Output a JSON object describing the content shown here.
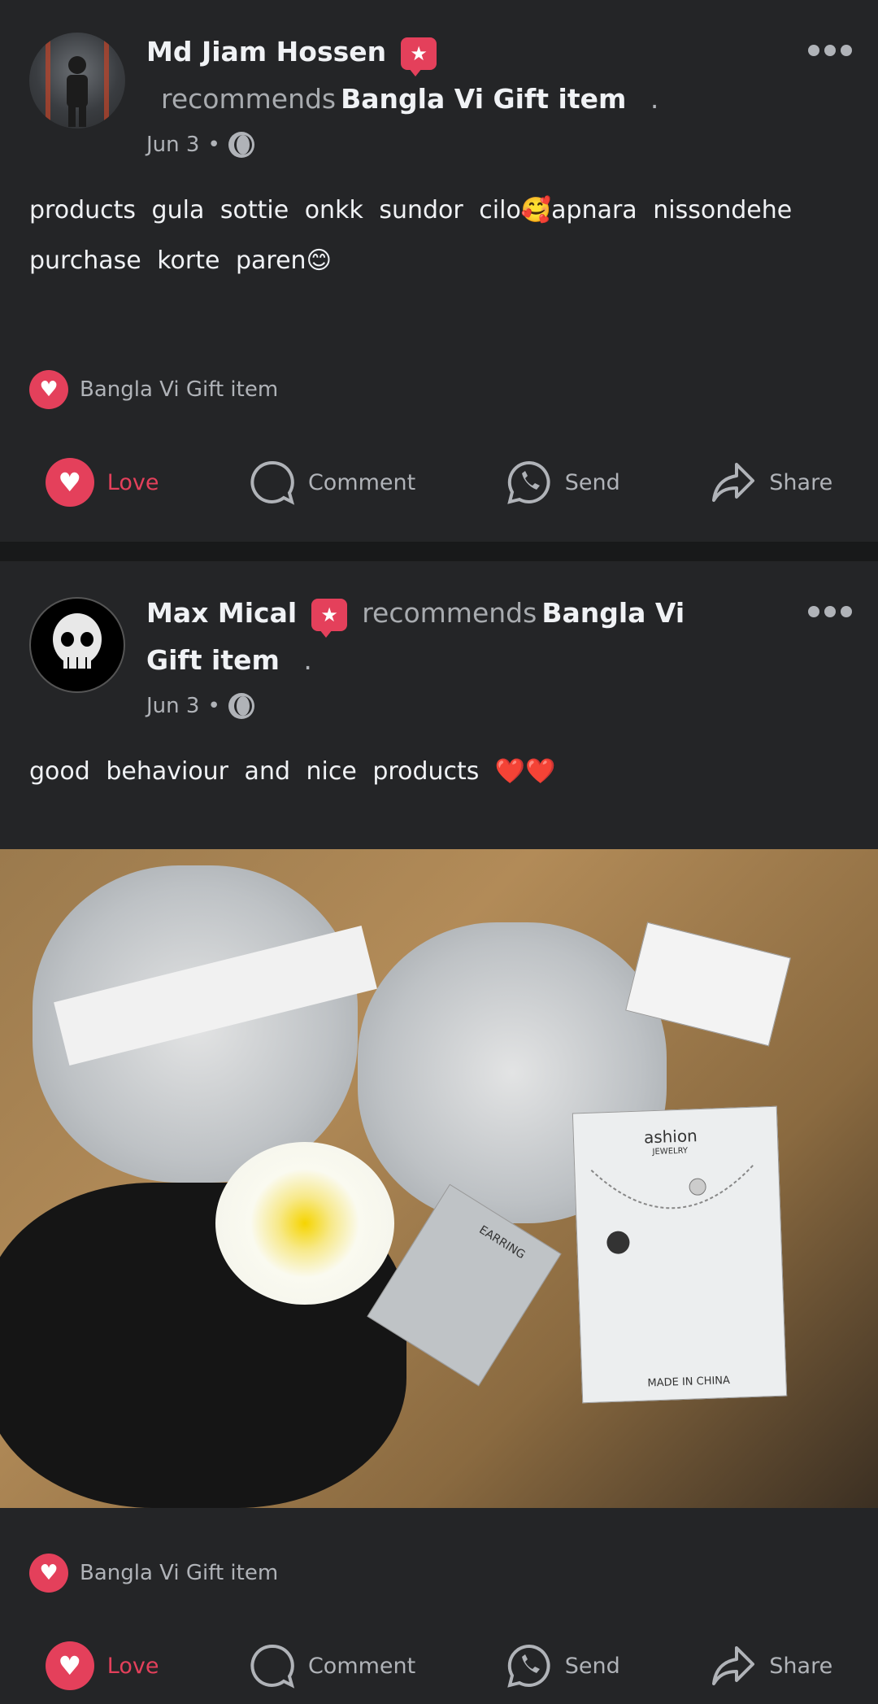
{
  "posts": [
    {
      "author": "Md Jiam Hossen",
      "recommends_word": "recommends",
      "page": "Bangla Vi Gift item",
      "page_suffix": ".",
      "date": "Jun 3",
      "separator": "•",
      "text": "products gula sottie onkk sundor cilo🥰apnara nissondehe purchase korte paren😊",
      "rec_label": "Bangla Vi Gift item",
      "actions": {
        "love": "Love",
        "comment": "Comment",
        "send": "Send",
        "share": "Share"
      }
    },
    {
      "author": "Max Mical",
      "recommends_word": "recommends",
      "page": "Bangla Vi Gift item",
      "page_suffix": ".",
      "date": "Jun 3",
      "separator": "•",
      "text": "good behaviour and nice products ❤️❤️",
      "photo_labels": {
        "brand": "ashion",
        "brand_sub": "JEWELRY",
        "made_in": "MADE IN CHINA",
        "earring": "EARRING"
      },
      "rec_label": "Bangla Vi Gift item",
      "actions": {
        "love": "Love",
        "comment": "Comment",
        "send": "Send",
        "share": "Share"
      }
    }
  ],
  "colors": {
    "background": "#242527",
    "accent": "#e4405b",
    "muted": "#b0b3b8"
  }
}
